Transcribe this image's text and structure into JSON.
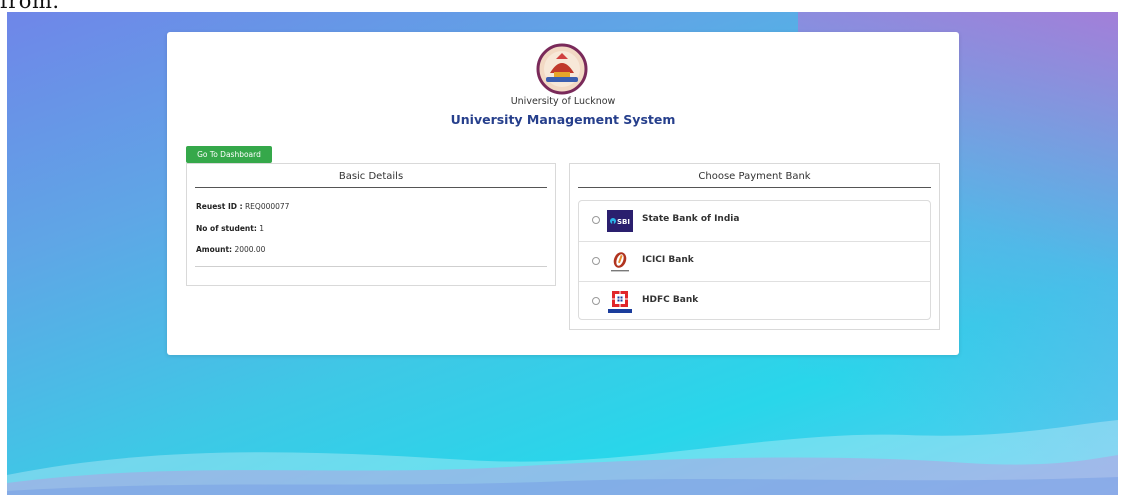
{
  "top_text": "from.",
  "header": {
    "university_name": "University of Lucknow",
    "system_title": "University Management System"
  },
  "actions": {
    "dashboard_label": "Go To Dashboard"
  },
  "basic_details": {
    "title": "Basic Details",
    "request_id_label": "Reuest ID :",
    "request_id_value": "REQ000077",
    "students_label": "No of student:",
    "students_value": "1",
    "amount_label": "Amount:",
    "amount_value": "2000.00"
  },
  "payment": {
    "title": "Choose Payment Bank",
    "banks": [
      {
        "name": "State Bank of India",
        "icon": "sbi-logo-icon",
        "selected": false
      },
      {
        "name": "ICICI Bank",
        "icon": "icici-logo-icon",
        "selected": false
      },
      {
        "name": "HDFC Bank",
        "icon": "hdfc-logo-icon",
        "selected": false
      }
    ]
  },
  "colors": {
    "accent_blue": "#263f8c",
    "button_green": "#35a84a",
    "sbi_purple": "#2a1f6e",
    "icici_orange": "#b0331f",
    "hdfc_blue": "#1b3d9c",
    "hdfc_red": "#e0262a"
  }
}
